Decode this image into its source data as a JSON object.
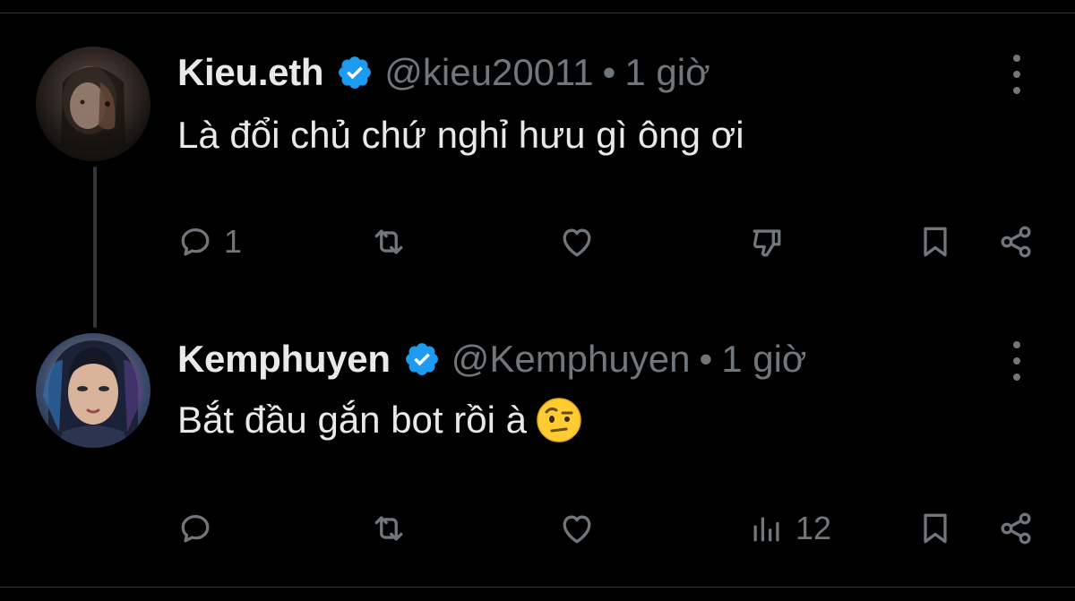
{
  "tweets": [
    {
      "name": "Kieu.eth",
      "handle": "@kieu20011",
      "separator": "•",
      "time": "1 giờ",
      "text": "Là đổi chủ chứ nghỉ hưu gì ông ơi",
      "emoji": "",
      "actions": {
        "reply_count": "1",
        "retweet_count": "",
        "like_count": "",
        "fourth_icon": "dislike-icon",
        "fourth_count": ""
      }
    },
    {
      "name": "Kemphuyen",
      "handle": "@Kemphuyen",
      "separator": "•",
      "time": "1 giờ",
      "text": "Bắt đầu gắn bot rồi à",
      "emoji": "face-with-raised-eyebrow",
      "actions": {
        "reply_count": "",
        "retweet_count": "",
        "like_count": "",
        "fourth_icon": "views-icon",
        "fourth_count": "12"
      }
    }
  ],
  "colors": {
    "background": "#000000",
    "primary_text": "#e7e9ea",
    "secondary_text": "#71767b",
    "verified_blue": "#1d9bf0",
    "divider": "#2f3336"
  }
}
